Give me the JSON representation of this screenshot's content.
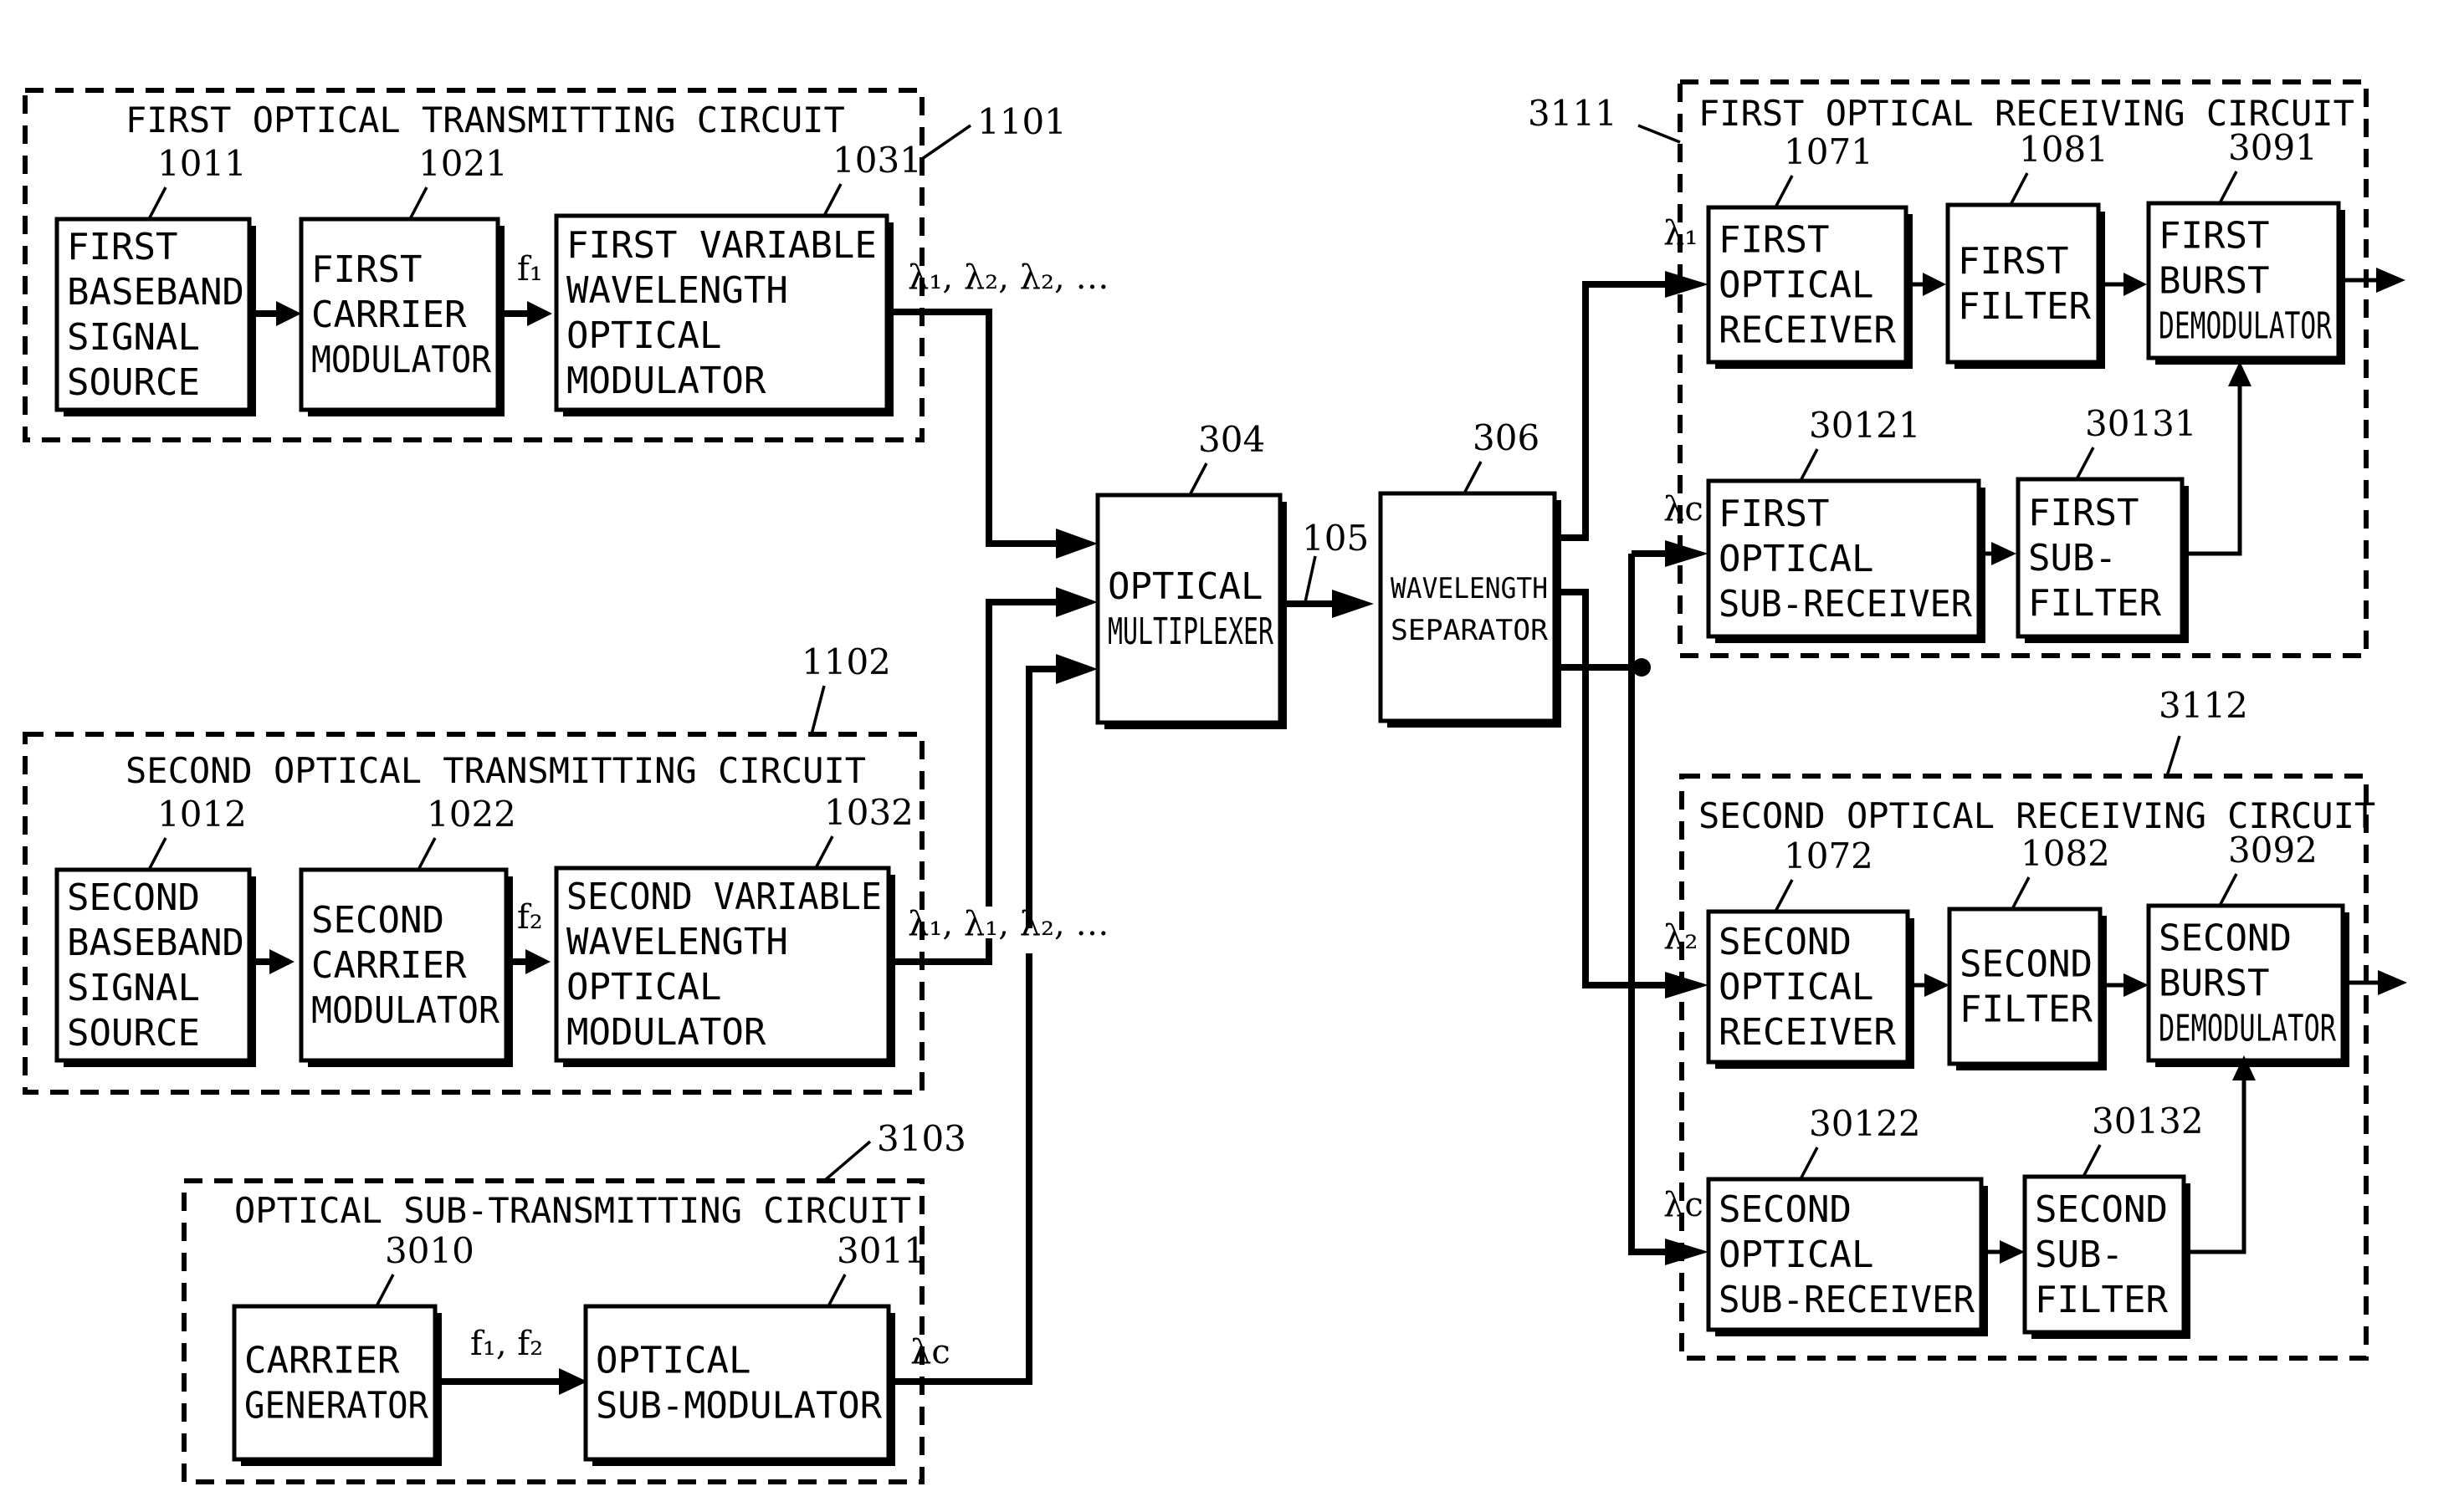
{
  "diagram": {
    "circuits": {
      "tx1": {
        "ref": "1101",
        "title": "FIRST OPTICAL TRANSMITTING CIRCUIT"
      },
      "tx2": {
        "ref": "1102",
        "title": "SECOND OPTICAL TRANSMITTING CIRCUIT"
      },
      "subtx": {
        "ref": "3103",
        "title": "OPTICAL SUB-TRANSMITTING CIRCUIT"
      },
      "rx1": {
        "ref": "3111",
        "title": "FIRST OPTICAL RECEIVING CIRCUIT"
      },
      "rx2": {
        "ref": "3112",
        "title": "SECOND OPTICAL RECEIVING CIRCUIT"
      }
    },
    "blocks": {
      "b1011": {
        "ref": "1011",
        "lines": [
          "FIRST",
          "BASEBAND",
          "SIGNAL",
          "SOURCE"
        ]
      },
      "b1021": {
        "ref": "1021",
        "lines": [
          "FIRST",
          "CARRIER",
          "MODULATOR"
        ]
      },
      "b1031": {
        "ref": "1031",
        "lines": [
          "FIRST VARIABLE",
          "WAVELENGTH",
          "OPTICAL",
          "MODULATOR"
        ]
      },
      "b1012": {
        "ref": "1012",
        "lines": [
          "SECOND",
          "BASEBAND",
          "SIGNAL",
          "SOURCE"
        ]
      },
      "b1022": {
        "ref": "1022",
        "lines": [
          "SECOND",
          "CARRIER",
          "MODULATOR"
        ]
      },
      "b1032": {
        "ref": "1032",
        "lines": [
          "SECOND VARIABLE",
          "WAVELENGTH",
          "OPTICAL",
          "MODULATOR"
        ]
      },
      "b3010": {
        "ref": "3010",
        "lines": [
          "CARRIER",
          "GENERATOR"
        ]
      },
      "b3011": {
        "ref": "3011",
        "lines": [
          "OPTICAL",
          "SUB-MODULATOR"
        ]
      },
      "b304": {
        "ref": "304",
        "lines": [
          "OPTICAL",
          "MULTIPLEXER"
        ]
      },
      "b306": {
        "ref": "306",
        "lines": [
          "WAVELENGTH",
          "SEPARATOR"
        ]
      },
      "b1071": {
        "ref": "1071",
        "lines": [
          "FIRST",
          "OPTICAL",
          "RECEIVER"
        ]
      },
      "b1081": {
        "ref": "1081",
        "lines": [
          "FIRST",
          "FILTER"
        ]
      },
      "b3091": {
        "ref": "3091",
        "lines": [
          "FIRST",
          "BURST",
          "DEMODULATOR"
        ]
      },
      "b30121": {
        "ref": "30121",
        "lines": [
          "FIRST",
          "OPTICAL",
          "SUB-RECEIVER"
        ]
      },
      "b30131": {
        "ref": "30131",
        "lines": [
          "FIRST",
          "SUB-",
          "FILTER"
        ]
      },
      "b1072": {
        "ref": "1072",
        "lines": [
          "SECOND",
          "OPTICAL",
          "RECEIVER"
        ]
      },
      "b1082": {
        "ref": "1082",
        "lines": [
          "SECOND",
          "FILTER"
        ]
      },
      "b3092": {
        "ref": "3092",
        "lines": [
          "SECOND",
          "BURST",
          "DEMODULATOR"
        ]
      },
      "b30122": {
        "ref": "30122",
        "lines": [
          "SECOND",
          "OPTICAL",
          "SUB-RECEIVER"
        ]
      },
      "b30132": {
        "ref": "30132",
        "lines": [
          "SECOND",
          "SUB-",
          "FILTER"
        ]
      }
    },
    "signals": {
      "f1": "f₁",
      "f2": "f₂",
      "f1f2": "f₁, f₂",
      "tx1_out": "λ₁, λ₂, λ₂, …",
      "tx2_out": "λ₁, λ₁, λ₂, …",
      "sub_out": "λc",
      "link": "105",
      "rx_l1": "λ₁",
      "rx_lc1": "λc",
      "rx_l2": "λ₂",
      "rx_lc2": "λc"
    }
  }
}
